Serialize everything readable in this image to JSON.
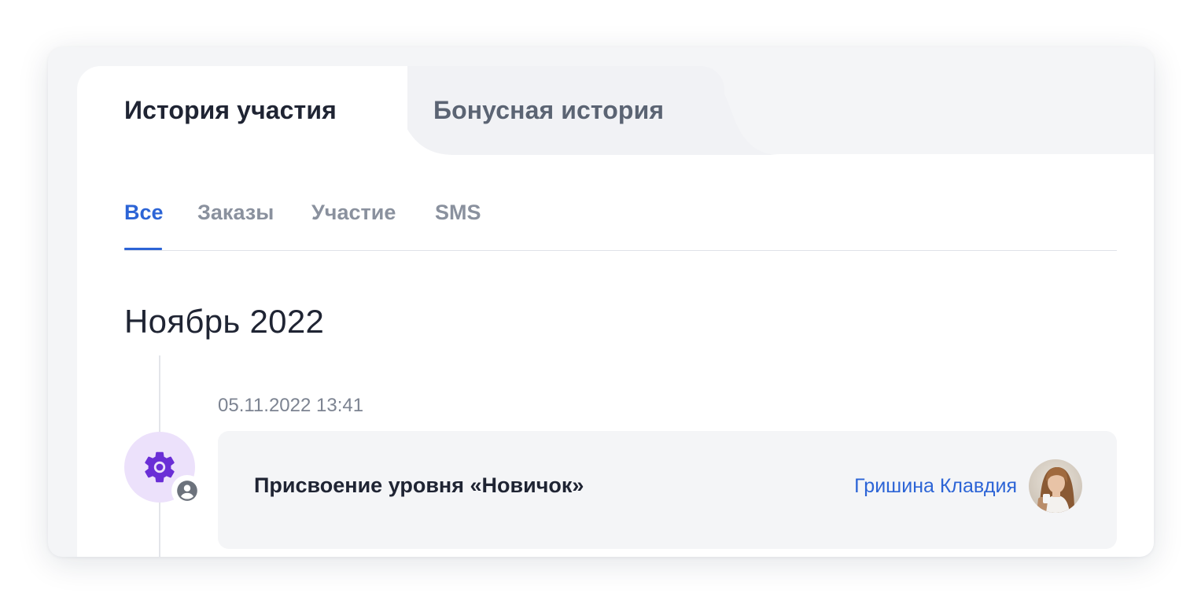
{
  "top_tabs": [
    {
      "label": "История участия",
      "active": true
    },
    {
      "label": "Бонусная история",
      "active": false
    }
  ],
  "sub_tabs": [
    {
      "label": "Все",
      "active": true
    },
    {
      "label": "Заказы",
      "active": false
    },
    {
      "label": "Участие",
      "active": false
    },
    {
      "label": "SMS",
      "active": false
    }
  ],
  "month_title": "Ноябрь 2022",
  "event": {
    "time": "05.11.2022 13:41",
    "title": "Присвоение уровня «Новичок»",
    "author": "Гришина Клавдия",
    "icon": "gear-icon",
    "badge_icon": "user-circle-icon"
  },
  "colors": {
    "accent": "#2c64d6",
    "icon_bg": "#ece1fb",
    "icon_purple": "#6a2ed6",
    "card_bg": "#f4f5f7"
  }
}
